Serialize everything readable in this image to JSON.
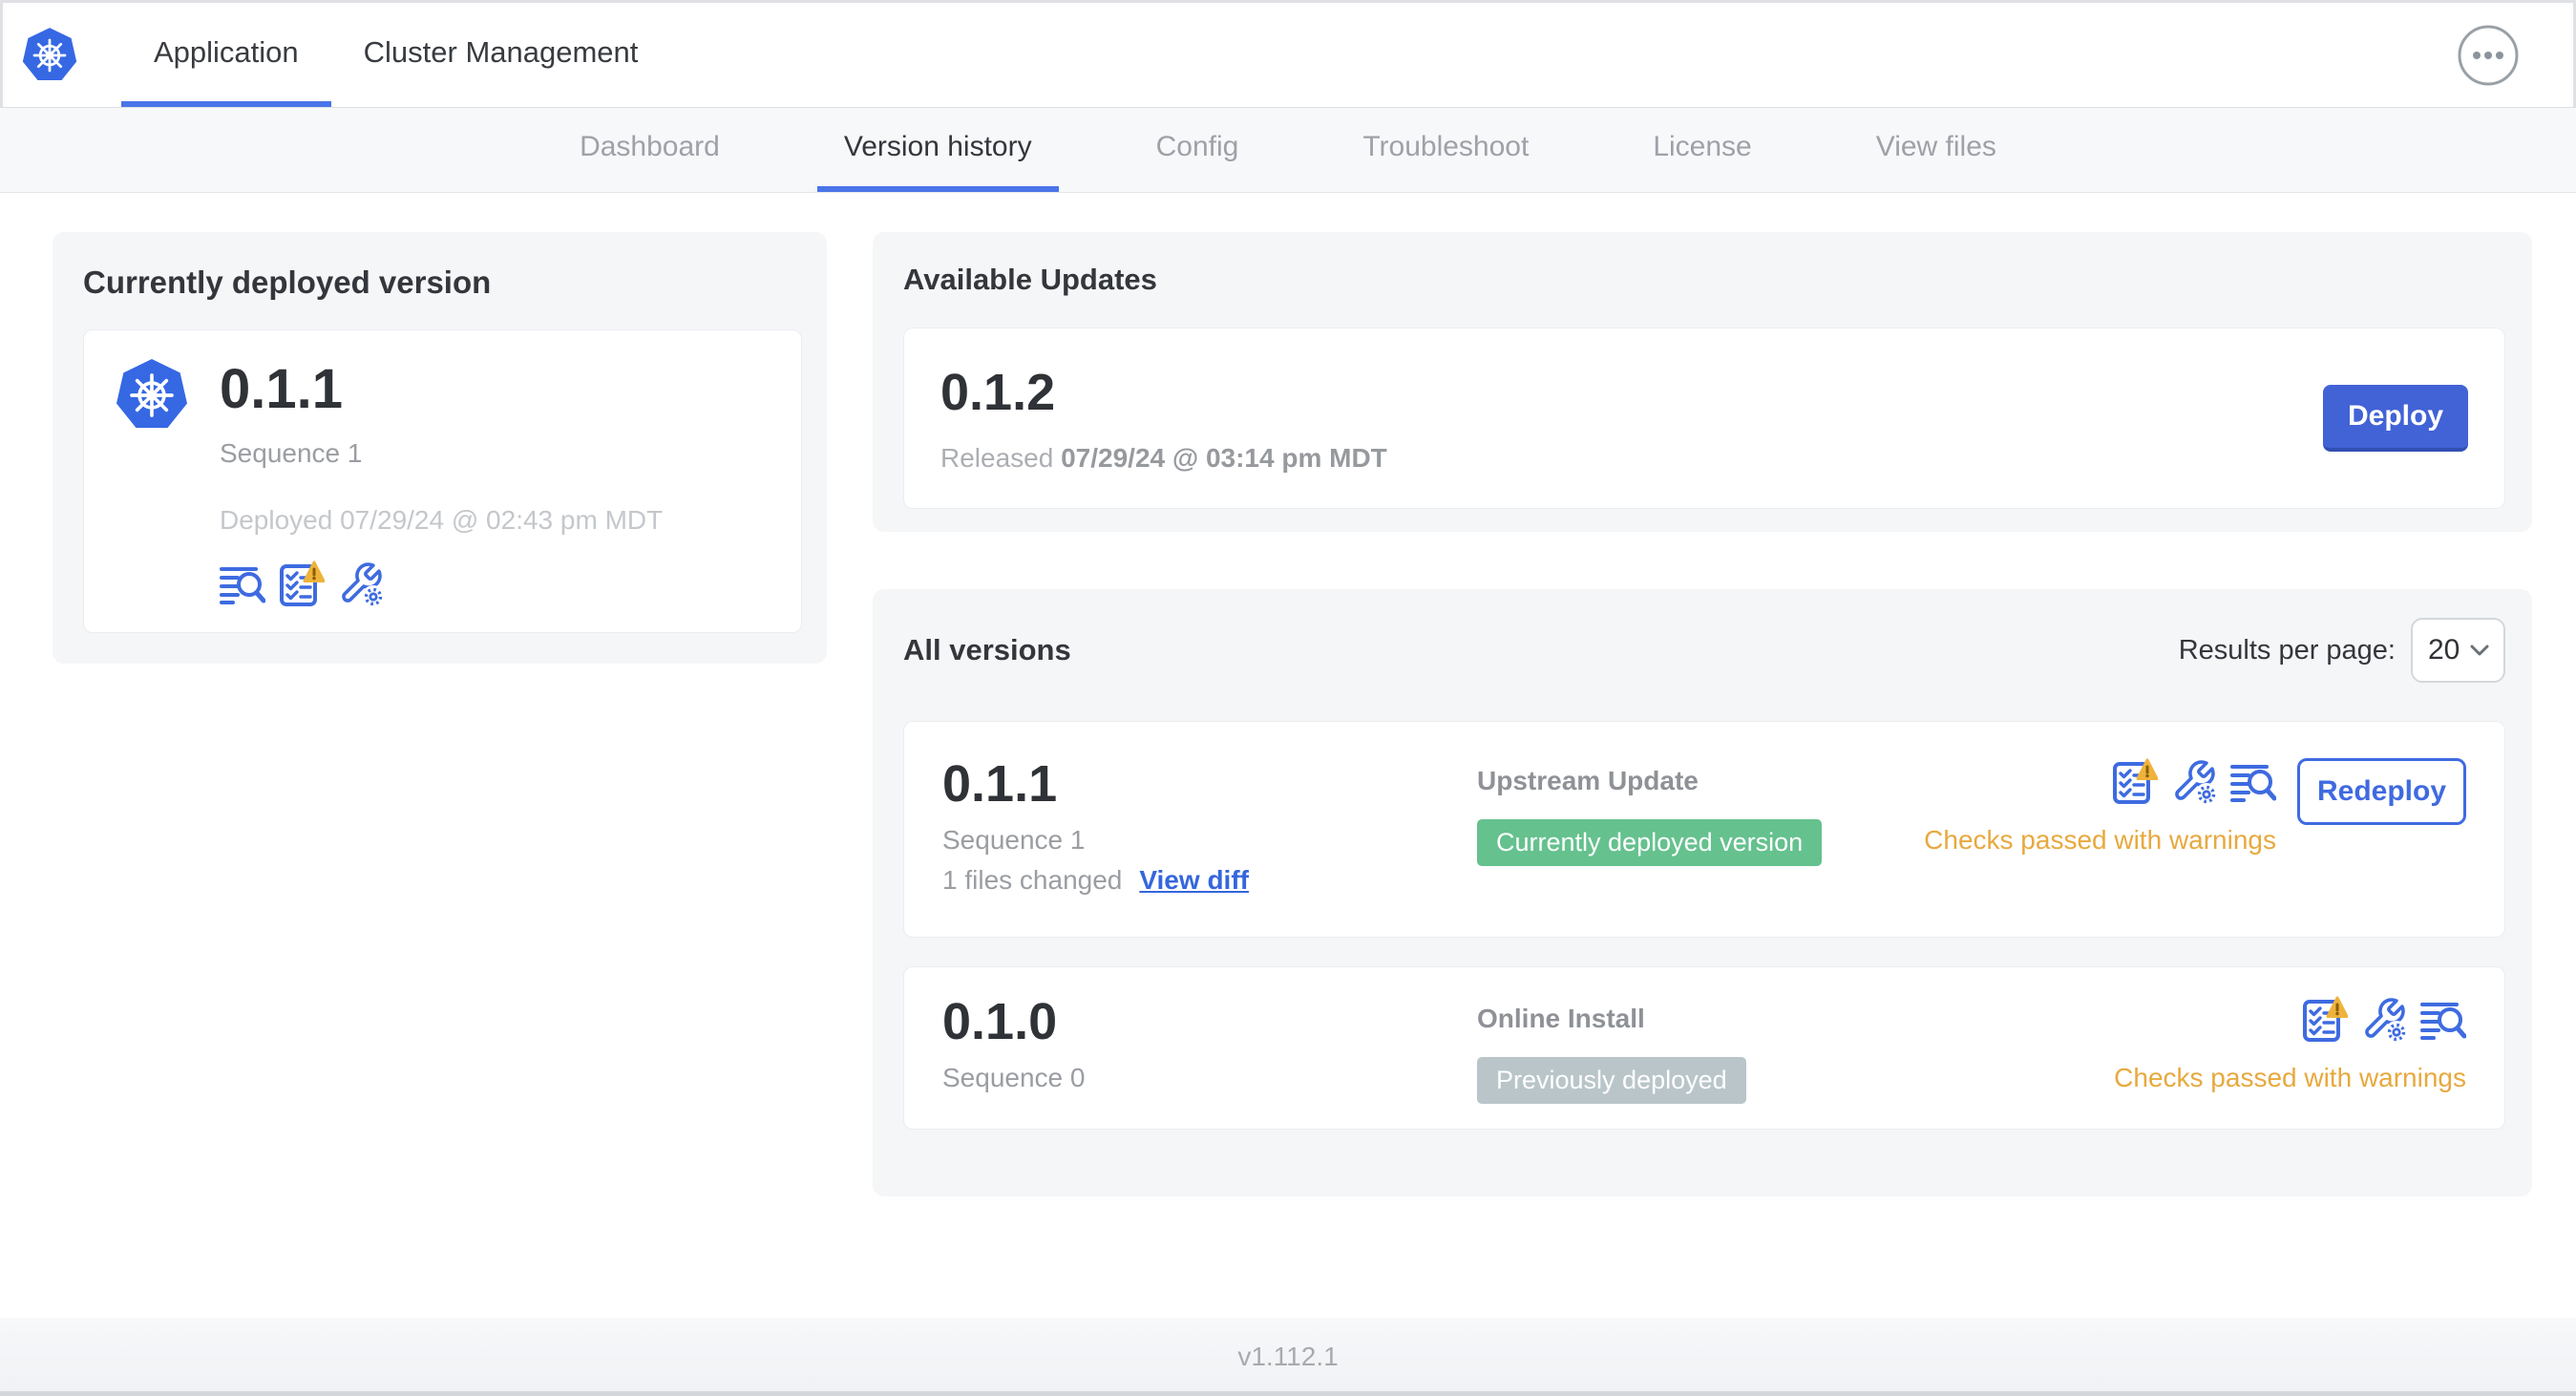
{
  "header": {
    "tabs": [
      {
        "label": "Application",
        "active": true
      },
      {
        "label": "Cluster Management",
        "active": false
      }
    ],
    "menu_icon": "ellipsis-icon",
    "logo_icon": "kubernetes-logo"
  },
  "subnav": {
    "tabs": [
      {
        "label": "Dashboard",
        "active": false
      },
      {
        "label": "Version history",
        "active": true
      },
      {
        "label": "Config",
        "active": false
      },
      {
        "label": "Troubleshoot",
        "active": false
      },
      {
        "label": "License",
        "active": false
      },
      {
        "label": "View files",
        "active": false
      }
    ]
  },
  "current": {
    "title": "Currently deployed version",
    "version": "0.1.1",
    "sequence": "Sequence 1",
    "deployed": "Deployed 07/29/24 @ 02:43 pm MDT",
    "icons": [
      "logs-icon",
      "preflight-checks-warning-icon",
      "config-icon"
    ]
  },
  "updates": {
    "title": "Available Updates",
    "version": "0.1.2",
    "released_prefix": "Released",
    "released_date": "07/29/24 @ 03:14 pm MDT",
    "deploy_label": "Deploy"
  },
  "allv": {
    "title": "All versions",
    "results_label": "Results per page:",
    "results_value": "20",
    "rows": [
      {
        "version": "0.1.1",
        "sequence": "Sequence 1",
        "files_changed": "1 files changed",
        "view_diff_label": "View diff",
        "source": "Upstream Update",
        "badge": "Currently deployed version",
        "status": "Checks passed with warnings",
        "action_label": "Redeploy",
        "icons": [
          "preflight-checks-warning-icon",
          "config-icon",
          "logs-icon"
        ]
      },
      {
        "version": "0.1.0",
        "sequence": "Sequence 0",
        "source": "Online Install",
        "badge": "Previously deployed",
        "status": "Checks passed with warnings",
        "icons": [
          "preflight-checks-warning-icon",
          "config-icon",
          "logs-icon"
        ]
      }
    ]
  },
  "footer": {
    "version": "v1.112.1"
  },
  "colors": {
    "accent_blue": "#3f6ae0",
    "deploy_blue": "#4263d6",
    "active_underline_blue": "#4a74e8",
    "warning_amber": "#e7a93e",
    "badge_green": "#65c18e",
    "badge_gray": "#b9c5c9",
    "card_gray": "#f5f6f8",
    "kubernetes_blue": "#3668e4"
  }
}
